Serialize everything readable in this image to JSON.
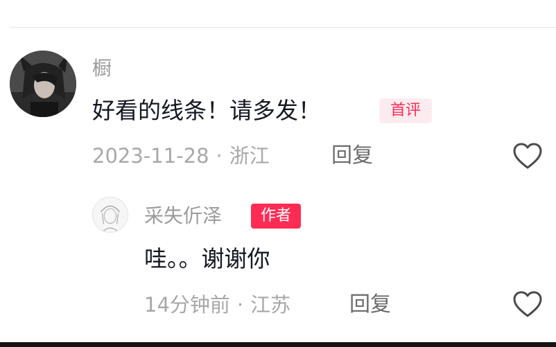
{
  "comment": {
    "username": "橱",
    "text": "好看的线条！请多发！",
    "badge": "首评",
    "date": "2023-11-28",
    "separator": "·",
    "location": "浙江",
    "reply_label": "回复",
    "like_icon": "heart-outline-icon"
  },
  "reply": {
    "username": "采失伒泽",
    "author_badge": "作者",
    "text": "哇。。谢谢你",
    "time": "14分钟前",
    "separator": "·",
    "location": "江苏",
    "reply_label": "回复",
    "like_icon": "heart-outline-icon"
  },
  "colors": {
    "accent": "#fe2c55",
    "badge_bg": "#fdecef",
    "muted_text": "#a8a8a8",
    "main_text": "#161823"
  }
}
